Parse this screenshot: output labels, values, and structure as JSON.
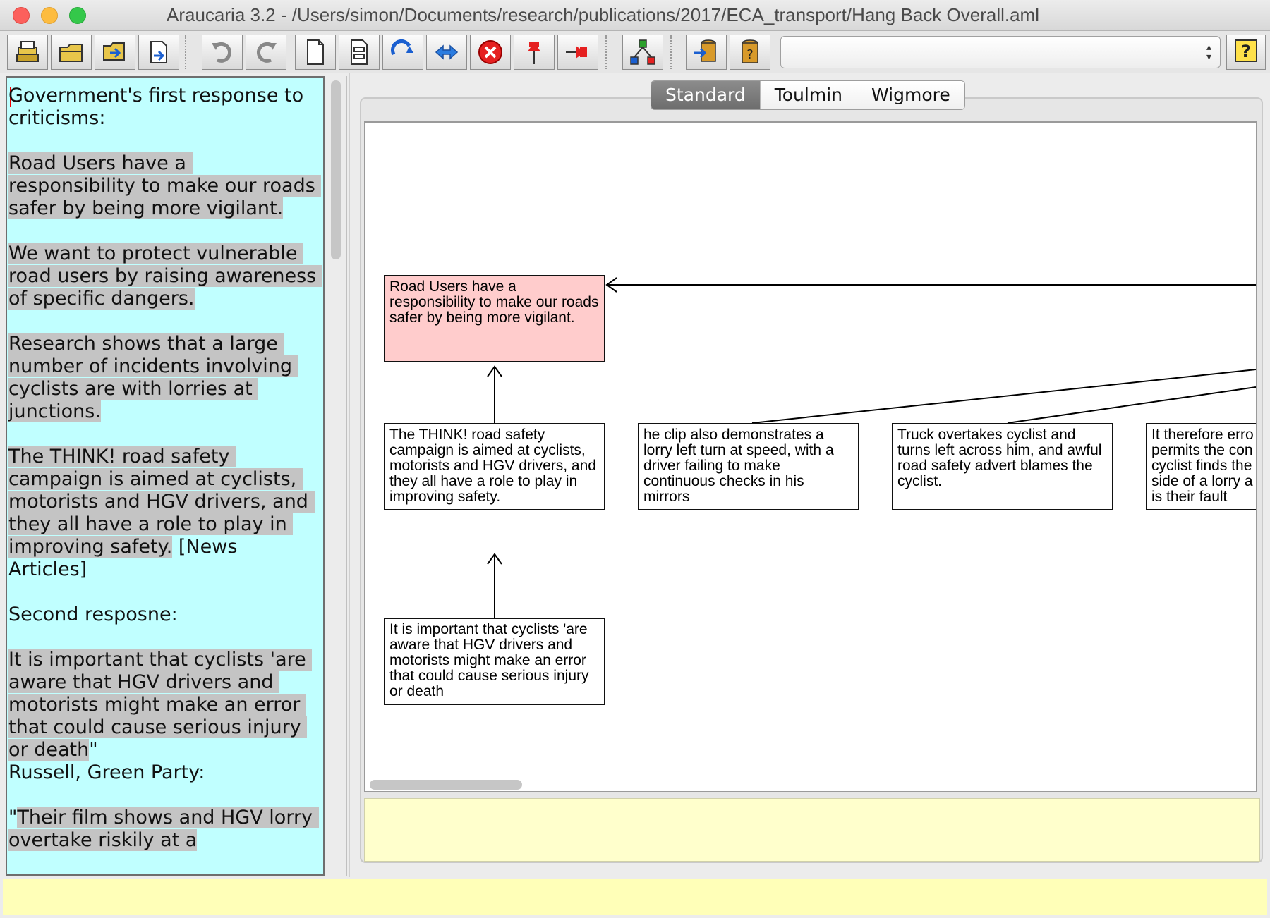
{
  "window": {
    "title": "Araucaria 3.2  - /Users/simon/Documents/research/publications/2017/ECA_transport/Hang Back Overall.aml"
  },
  "toolbar": {
    "buttons": [
      {
        "name": "open-icon"
      },
      {
        "name": "open-folder-icon"
      },
      {
        "name": "save-icon"
      },
      {
        "name": "export-icon"
      },
      {
        "name": "undo-icon"
      },
      {
        "name": "redo-icon"
      },
      {
        "name": "new-document-icon"
      },
      {
        "name": "document-properties-icon"
      },
      {
        "name": "link-icon"
      },
      {
        "name": "refutation-icon"
      },
      {
        "name": "delete-icon"
      },
      {
        "name": "pin-icon"
      },
      {
        "name": "unpin-icon"
      },
      {
        "name": "tree-layout-icon"
      },
      {
        "name": "database-upload-icon"
      },
      {
        "name": "database-query-icon"
      },
      {
        "name": "help-icon"
      }
    ],
    "scheme_combo_value": ""
  },
  "source_text": {
    "blocks": [
      {
        "segments": [
          {
            "text": "Government's first response to criticisms:",
            "highlight": false
          }
        ]
      },
      {
        "segments": [
          {
            "text": "Road Users have a responsibility to make our roads safer by being more vigilant.",
            "highlight": true
          }
        ]
      },
      {
        "segments": [
          {
            "text": "We want to protect vulnerable road users by raising awareness of specific dangers.",
            "highlight": true
          }
        ]
      },
      {
        "segments": [
          {
            "text": "Research shows that a large number of incidents involving cyclists are with lorries at junctions.",
            "highlight": true
          }
        ]
      },
      {
        "segments": [
          {
            "text": "The THINK! road safety campaign is aimed at cyclists, motorists and HGV drivers, and they all have a role to play in improving safety.",
            "highlight": true
          },
          {
            "text": " [News Articles]",
            "highlight": false
          }
        ]
      },
      {
        "segments": [
          {
            "text": "Second resposne:",
            "highlight": false
          }
        ]
      },
      {
        "segments": [
          {
            "text": "It is important that cyclists 'are aware that HGV drivers and motorists might make an error that could cause serious injury or death",
            "highlight": true
          },
          {
            "text": "\"\nRussell, Green Party:",
            "highlight": false
          }
        ]
      },
      {
        "segments": [
          {
            "text": "\"",
            "highlight": false
          },
          {
            "text": "Their film shows and HGV lorry overtake riskily at a",
            "highlight": true
          }
        ]
      }
    ]
  },
  "tabs": [
    {
      "label": "Standard",
      "active": true
    },
    {
      "label": "Toulmin",
      "active": false
    },
    {
      "label": "Wigmore",
      "active": false
    }
  ],
  "diagram": {
    "nodes": [
      {
        "id": "n1",
        "text": "Road Users have a responsibility to make our roads safer by being more vigilant.",
        "type": "conclusion"
      },
      {
        "id": "n2",
        "text": "The THINK! road safety campaign is aimed at cyclists, motorists and HGV drivers, and they all have a role to play in improving safety.",
        "type": "premise"
      },
      {
        "id": "n3",
        "text": "he clip also demonstrates a lorry left turn at speed, with a driver failing to make continuous checks in his mirrors",
        "type": "premise"
      },
      {
        "id": "n4",
        "text": "Truck overtakes cyclist and turns left across him, and awful road safety advert blames the cyclist.",
        "type": "premise"
      },
      {
        "id": "n5",
        "text": "It therefore erro permits the con cyclist finds the side of a lorry a is their fault",
        "type": "premise"
      },
      {
        "id": "n6",
        "text": "It is important that cyclists 'are aware that HGV drivers and motorists might make an error that could cause serious injury or death",
        "type": "premise"
      }
    ],
    "edges": [
      {
        "from": "n2",
        "to": "n1"
      },
      {
        "from": "n6",
        "to": "n2"
      }
    ]
  },
  "colors": {
    "source_background": "#c0ffff",
    "highlight": "#c4c4c4",
    "conclusion_node": "#ffcccc",
    "evaluation_area": "#ffffcc",
    "status_bar": "#ffffb8"
  }
}
